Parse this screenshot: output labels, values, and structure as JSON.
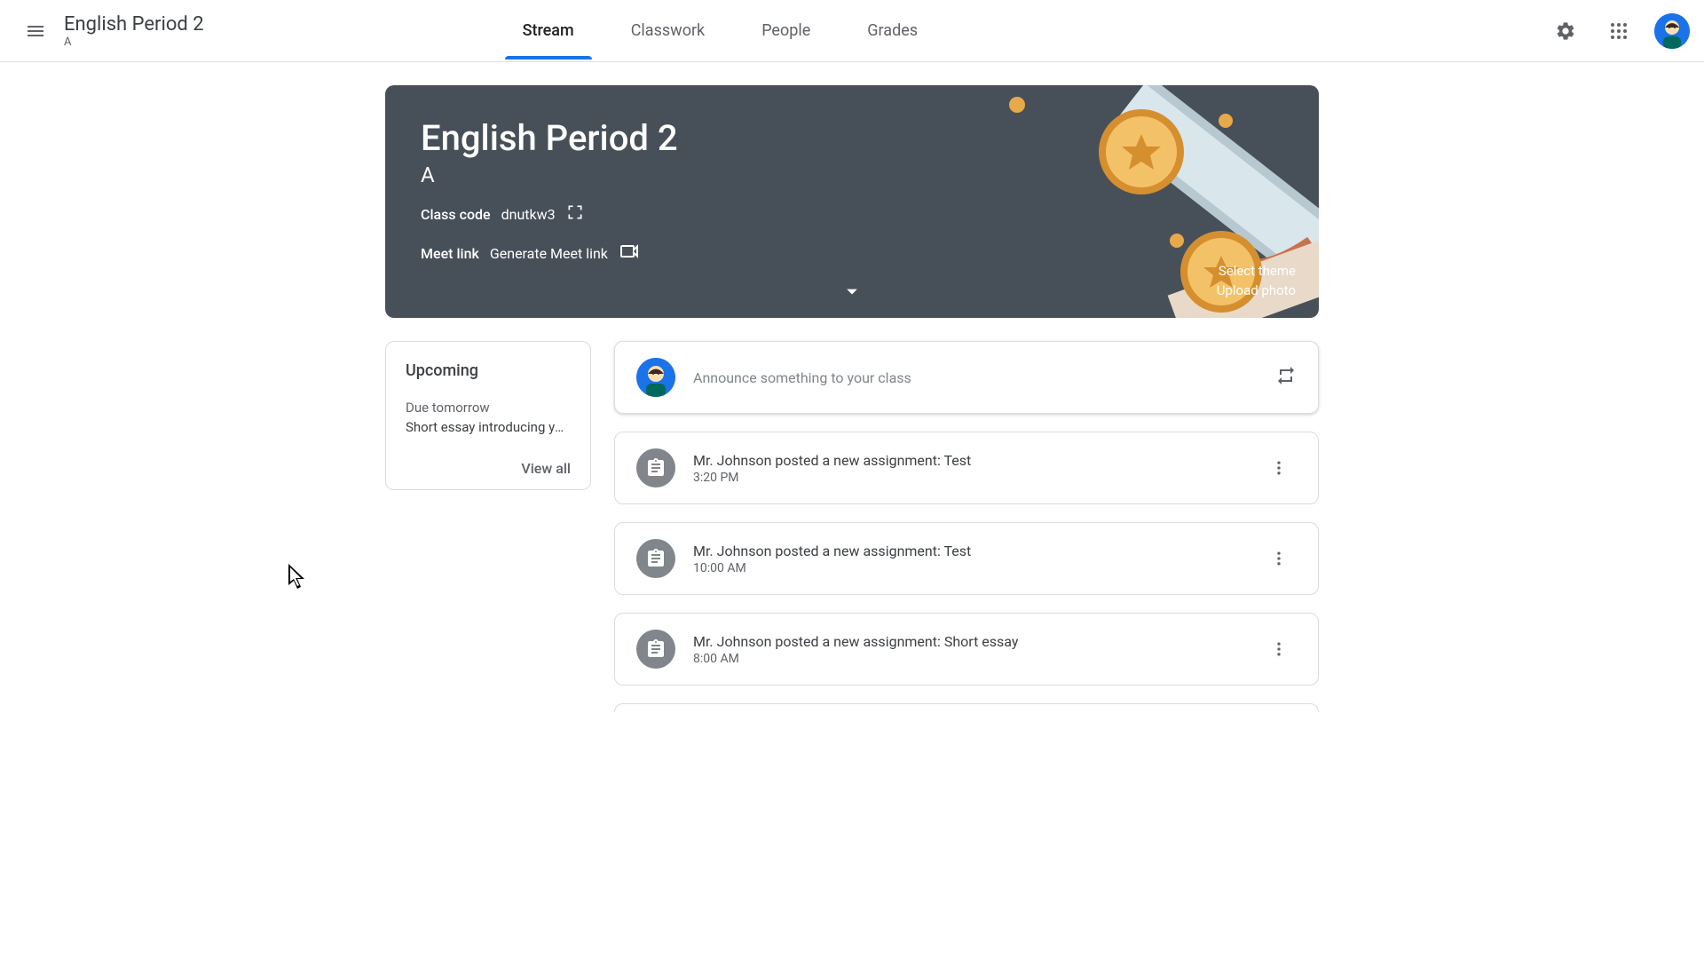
{
  "header": {
    "class_title": "English Period 2",
    "class_section": "A",
    "tabs": [
      "Stream",
      "Classwork",
      "People",
      "Grades"
    ],
    "active_tab": 0
  },
  "banner": {
    "title": "English Period 2",
    "section": "A",
    "class_code_label": "Class code",
    "class_code": "dnutkw3",
    "meet_label": "Meet link",
    "meet_action": "Generate Meet link",
    "select_theme": "Select theme",
    "upload_photo": "Upload photo"
  },
  "upcoming": {
    "title": "Upcoming",
    "due_label": "Due tomorrow",
    "item": "Short essay introducing yo…",
    "view_all": "View all"
  },
  "announce": {
    "placeholder": "Announce something to your class"
  },
  "posts": [
    {
      "title": "Mr. Johnson posted a new assignment: Test",
      "time": "3:20 PM"
    },
    {
      "title": "Mr. Johnson posted a new assignment: Test",
      "time": "10:00 AM"
    },
    {
      "title": "Mr. Johnson posted a new assignment: Short essay",
      "time": "8:00 AM"
    }
  ]
}
